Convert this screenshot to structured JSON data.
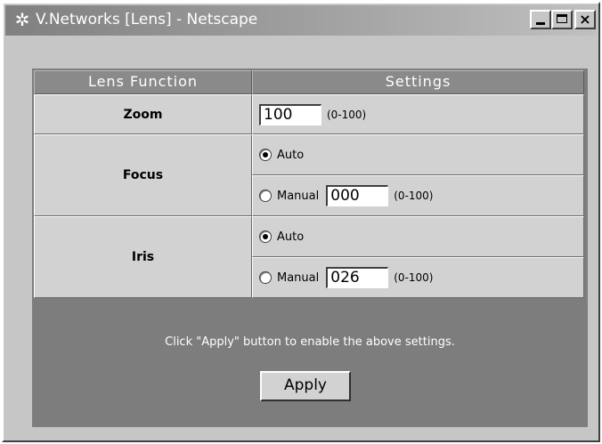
{
  "window": {
    "title": "V.Networks [Lens] - Netscape",
    "app_icon": "netscape-icon",
    "controls": {
      "minimize": "minimize-icon",
      "maximize": "maximize-icon",
      "close_glyph": "×"
    }
  },
  "table": {
    "header_function": "Lens Function",
    "header_settings": "Settings",
    "zoom": {
      "label": "Zoom",
      "value": "100",
      "range": "(0-100)"
    },
    "focus": {
      "label": "Focus",
      "auto_label": "Auto",
      "manual_label": "Manual",
      "manual_value": "000",
      "range": "(0-100)",
      "selected": "auto"
    },
    "iris": {
      "label": "Iris",
      "auto_label": "Auto",
      "manual_label": "Manual",
      "manual_value": "026",
      "range": "(0-100)",
      "selected": "auto"
    }
  },
  "footer": {
    "message": "Click \"Apply\" button to enable the above settings.",
    "apply_label": "Apply"
  },
  "colors": {
    "window_bg": "#c6c6c6",
    "panel_bg": "#7d7d7d",
    "cell_bg": "#d2d2d2",
    "titlebar": "#808080"
  }
}
